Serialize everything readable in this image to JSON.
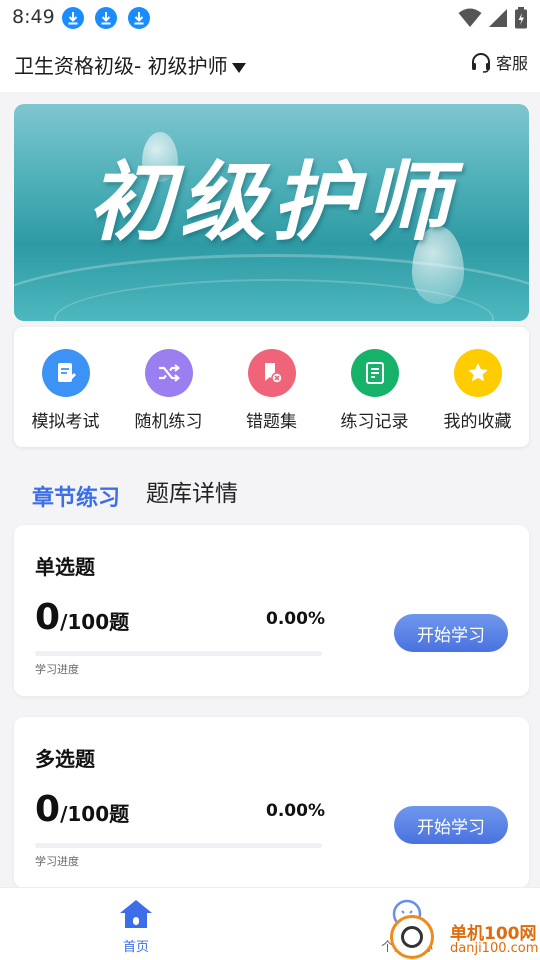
{
  "status_bar": {
    "time": "8:49"
  },
  "header": {
    "title": "卫生资格初级- 初级护师",
    "service_label": "客服"
  },
  "banner": {
    "text": "初级护师"
  },
  "quick_actions": [
    {
      "label": "模拟考试",
      "icon": "exam-doc-icon",
      "color": "#3d93f5"
    },
    {
      "label": "随机练习",
      "icon": "shuffle-icon",
      "color": "#9b7ef0"
    },
    {
      "label": "错题集",
      "icon": "wrong-book-icon",
      "color": "#f0647a"
    },
    {
      "label": "练习记录",
      "icon": "record-icon",
      "color": "#17b26a"
    },
    {
      "label": "我的收藏",
      "icon": "star-icon",
      "color": "#ffcc00"
    }
  ],
  "tabs": {
    "active": "章节练习",
    "inactive": "题库详情"
  },
  "cards": [
    {
      "title": "单选题",
      "done": "0",
      "total": "/100题",
      "percent": "0.00%",
      "progress": 0,
      "progress_label": "学习进度",
      "button": "开始学习"
    },
    {
      "title": "多选题",
      "done": "0",
      "total": "/100题",
      "percent": "0.00%",
      "progress": 0,
      "progress_label": "学习进度",
      "button": "开始学习"
    }
  ],
  "bottom_nav": {
    "home": "首页",
    "me": "个人中心"
  },
  "watermark": {
    "line1": "单机100网",
    "line2": "danji100.com"
  },
  "colors": {
    "accent": "#3b6ee8",
    "button_gradient_top": "#6f97ec",
    "button_gradient_bottom": "#4a72e0"
  }
}
